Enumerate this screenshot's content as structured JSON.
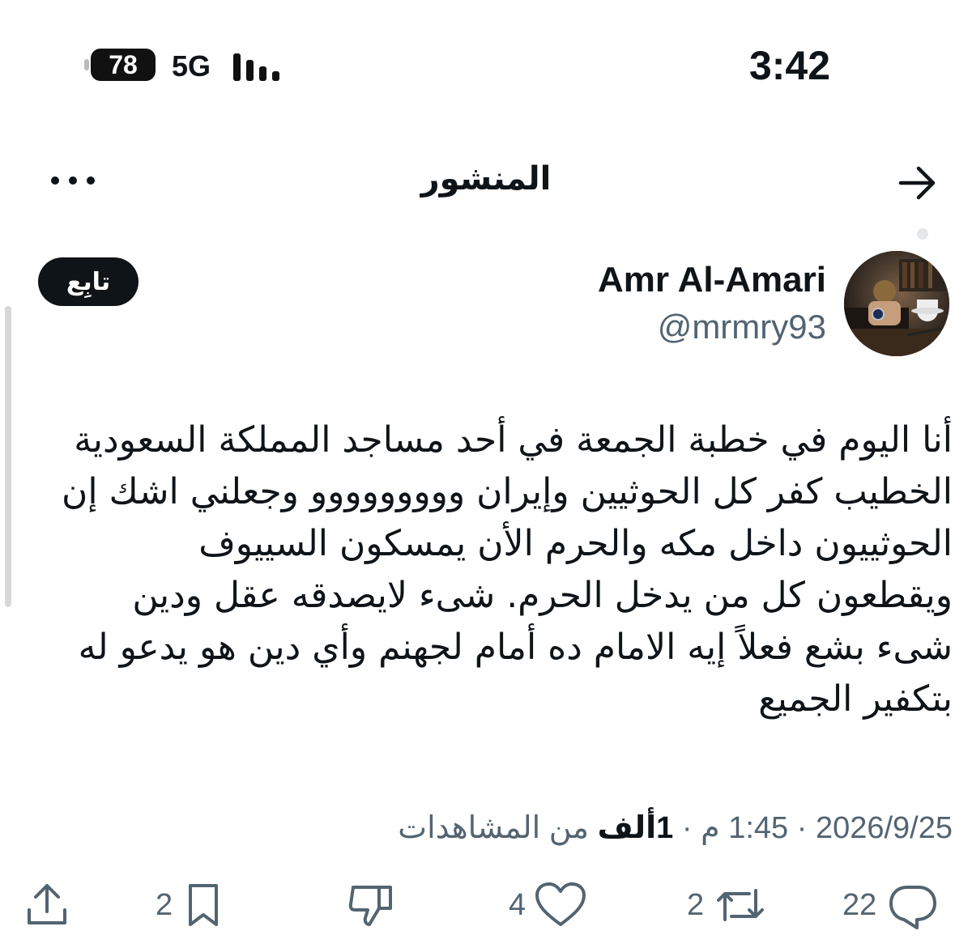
{
  "status_bar": {
    "battery_level": "78",
    "network": "5G",
    "time": "3:42",
    "icons": [
      "battery-icon",
      "signal-bars-icon"
    ]
  },
  "header": {
    "title": "المنشور",
    "icons": [
      "back-arrow-icon",
      "more-options-icon"
    ]
  },
  "author": {
    "name": "Amr Al-Amari",
    "handle": "@mrmry93",
    "follow_label": "تابِع",
    "icons": [
      "avatar"
    ]
  },
  "tweet": {
    "lines": [
      "أنا اليوم في خطبة الجمعة في أحد مساجد المملكة السعودية",
      "الخطيب كفر كل الحوثيين وإيران ووووووووو وجعلني اشك إن",
      "الحوثييون داخل مكه والحرم الأن يمسكون السييوف",
      "ويقطعون كل من يدخل الحرم. شىء لايصدقه عقل ودين",
      "شىء بشع فعلاً إيه الامام ده أمام لجهنم وأي دين هو يدعو له",
      "بتكفير الجميع"
    ]
  },
  "meta": {
    "date": "2026/9/25",
    "separator": "·",
    "time": "1:45 م",
    "views_count": "1ألف",
    "views_label": "من المشاهدات"
  },
  "actions": {
    "replies": "22",
    "reposts": "2",
    "likes": "4",
    "bookmarks": "2",
    "icons": [
      "reply-icon",
      "repost-icon",
      "like-icon",
      "dislike-icon",
      "bookmark-icon",
      "share-icon"
    ]
  },
  "colors": {
    "text": "#0f1419",
    "secondary": "#536471",
    "follow_bg": "#0f1419",
    "follow_text": "#ffffff"
  }
}
